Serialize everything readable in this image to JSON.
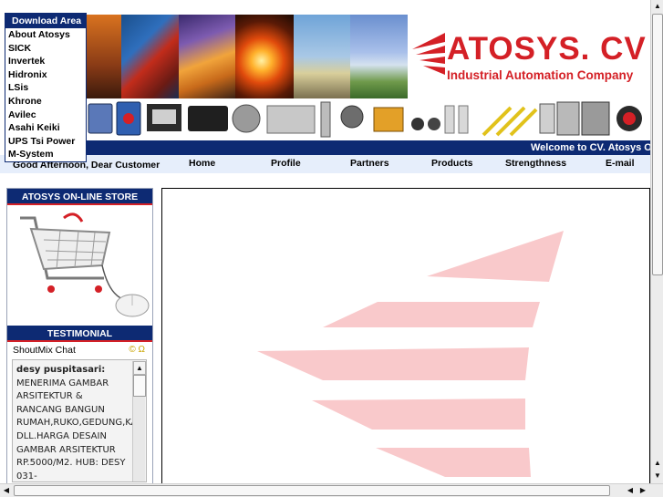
{
  "menu": {
    "header": "Download Area",
    "items": [
      "About Atosys",
      "SICK",
      "Invertek",
      "Hidronix",
      "LSis",
      "Khrone",
      "Avilec",
      "Asahi Keiki",
      "UPS Tsi Power",
      "M-System"
    ]
  },
  "logo": {
    "name": "ATOSYS. CV",
    "tagline": "Industrial Automation Company"
  },
  "welcome": "Welcome to CV. Atosys Offi",
  "greeting": "Good Afternoon, Dear Customer",
  "nav": [
    "Home",
    "Profile",
    "Partners",
    "Products",
    "Strengthness",
    "E-mail"
  ],
  "sidebar": {
    "store_title": "ATOSYS ON-LINE STORE",
    "testimonial_title": "TESTIMONIAL",
    "shoutmix_label": "ShoutMix Chat",
    "shoutmix_icons": "© Ω",
    "message_author": "desy puspitasari:",
    "message_lines": [
      "MENERIMA GAMBAR",
      "ARSITEKTUR &",
      "RANCANG BANGUN",
      "RUMAH,RUKO,GEDUNG,KA",
      "DLL.HARGA DESAIN",
      "GAMBAR ARSITEKTUR",
      "RP.5000/M2. HUB: DESY",
      "031-"
    ]
  },
  "colors": {
    "brand_red": "#d42026",
    "nav_blue": "#0d2a73",
    "navbar_bg": "#e6eefb",
    "watermark_pink": "#f9c9cb"
  },
  "icons": {
    "up_arrow": "▲",
    "down_arrow": "▼",
    "left_arrow": "◀",
    "right_arrow": "▶"
  }
}
